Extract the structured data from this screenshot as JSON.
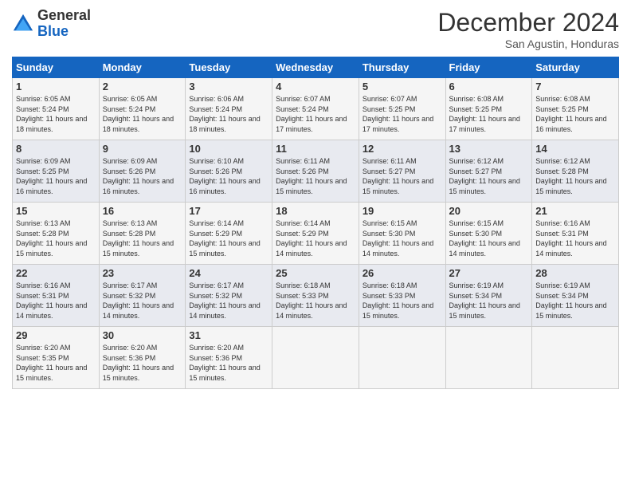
{
  "logo": {
    "general": "General",
    "blue": "Blue"
  },
  "title": "December 2024",
  "location": "San Agustin, Honduras",
  "days_of_week": [
    "Sunday",
    "Monday",
    "Tuesday",
    "Wednesday",
    "Thursday",
    "Friday",
    "Saturday"
  ],
  "weeks": [
    [
      {
        "day": "1",
        "sunrise": "6:05 AM",
        "sunset": "5:24 PM",
        "daylight": "11 hours and 18 minutes."
      },
      {
        "day": "2",
        "sunrise": "6:05 AM",
        "sunset": "5:24 PM",
        "daylight": "11 hours and 18 minutes."
      },
      {
        "day": "3",
        "sunrise": "6:06 AM",
        "sunset": "5:24 PM",
        "daylight": "11 hours and 18 minutes."
      },
      {
        "day": "4",
        "sunrise": "6:07 AM",
        "sunset": "5:24 PM",
        "daylight": "11 hours and 17 minutes."
      },
      {
        "day": "5",
        "sunrise": "6:07 AM",
        "sunset": "5:25 PM",
        "daylight": "11 hours and 17 minutes."
      },
      {
        "day": "6",
        "sunrise": "6:08 AM",
        "sunset": "5:25 PM",
        "daylight": "11 hours and 17 minutes."
      },
      {
        "day": "7",
        "sunrise": "6:08 AM",
        "sunset": "5:25 PM",
        "daylight": "11 hours and 16 minutes."
      }
    ],
    [
      {
        "day": "8",
        "sunrise": "6:09 AM",
        "sunset": "5:25 PM",
        "daylight": "11 hours and 16 minutes."
      },
      {
        "day": "9",
        "sunrise": "6:09 AM",
        "sunset": "5:26 PM",
        "daylight": "11 hours and 16 minutes."
      },
      {
        "day": "10",
        "sunrise": "6:10 AM",
        "sunset": "5:26 PM",
        "daylight": "11 hours and 16 minutes."
      },
      {
        "day": "11",
        "sunrise": "6:11 AM",
        "sunset": "5:26 PM",
        "daylight": "11 hours and 15 minutes."
      },
      {
        "day": "12",
        "sunrise": "6:11 AM",
        "sunset": "5:27 PM",
        "daylight": "11 hours and 15 minutes."
      },
      {
        "day": "13",
        "sunrise": "6:12 AM",
        "sunset": "5:27 PM",
        "daylight": "11 hours and 15 minutes."
      },
      {
        "day": "14",
        "sunrise": "6:12 AM",
        "sunset": "5:28 PM",
        "daylight": "11 hours and 15 minutes."
      }
    ],
    [
      {
        "day": "15",
        "sunrise": "6:13 AM",
        "sunset": "5:28 PM",
        "daylight": "11 hours and 15 minutes."
      },
      {
        "day": "16",
        "sunrise": "6:13 AM",
        "sunset": "5:28 PM",
        "daylight": "11 hours and 15 minutes."
      },
      {
        "day": "17",
        "sunrise": "6:14 AM",
        "sunset": "5:29 PM",
        "daylight": "11 hours and 15 minutes."
      },
      {
        "day": "18",
        "sunrise": "6:14 AM",
        "sunset": "5:29 PM",
        "daylight": "11 hours and 14 minutes."
      },
      {
        "day": "19",
        "sunrise": "6:15 AM",
        "sunset": "5:30 PM",
        "daylight": "11 hours and 14 minutes."
      },
      {
        "day": "20",
        "sunrise": "6:15 AM",
        "sunset": "5:30 PM",
        "daylight": "11 hours and 14 minutes."
      },
      {
        "day": "21",
        "sunrise": "6:16 AM",
        "sunset": "5:31 PM",
        "daylight": "11 hours and 14 minutes."
      }
    ],
    [
      {
        "day": "22",
        "sunrise": "6:16 AM",
        "sunset": "5:31 PM",
        "daylight": "11 hours and 14 minutes."
      },
      {
        "day": "23",
        "sunrise": "6:17 AM",
        "sunset": "5:32 PM",
        "daylight": "11 hours and 14 minutes."
      },
      {
        "day": "24",
        "sunrise": "6:17 AM",
        "sunset": "5:32 PM",
        "daylight": "11 hours and 14 minutes."
      },
      {
        "day": "25",
        "sunrise": "6:18 AM",
        "sunset": "5:33 PM",
        "daylight": "11 hours and 14 minutes."
      },
      {
        "day": "26",
        "sunrise": "6:18 AM",
        "sunset": "5:33 PM",
        "daylight": "11 hours and 15 minutes."
      },
      {
        "day": "27",
        "sunrise": "6:19 AM",
        "sunset": "5:34 PM",
        "daylight": "11 hours and 15 minutes."
      },
      {
        "day": "28",
        "sunrise": "6:19 AM",
        "sunset": "5:34 PM",
        "daylight": "11 hours and 15 minutes."
      }
    ],
    [
      {
        "day": "29",
        "sunrise": "6:20 AM",
        "sunset": "5:35 PM",
        "daylight": "11 hours and 15 minutes."
      },
      {
        "day": "30",
        "sunrise": "6:20 AM",
        "sunset": "5:36 PM",
        "daylight": "11 hours and 15 minutes."
      },
      {
        "day": "31",
        "sunrise": "6:20 AM",
        "sunset": "5:36 PM",
        "daylight": "11 hours and 15 minutes."
      },
      {
        "day": "",
        "sunrise": "",
        "sunset": "",
        "daylight": ""
      },
      {
        "day": "",
        "sunrise": "",
        "sunset": "",
        "daylight": ""
      },
      {
        "day": "",
        "sunrise": "",
        "sunset": "",
        "daylight": ""
      },
      {
        "day": "",
        "sunrise": "",
        "sunset": "",
        "daylight": ""
      }
    ]
  ]
}
